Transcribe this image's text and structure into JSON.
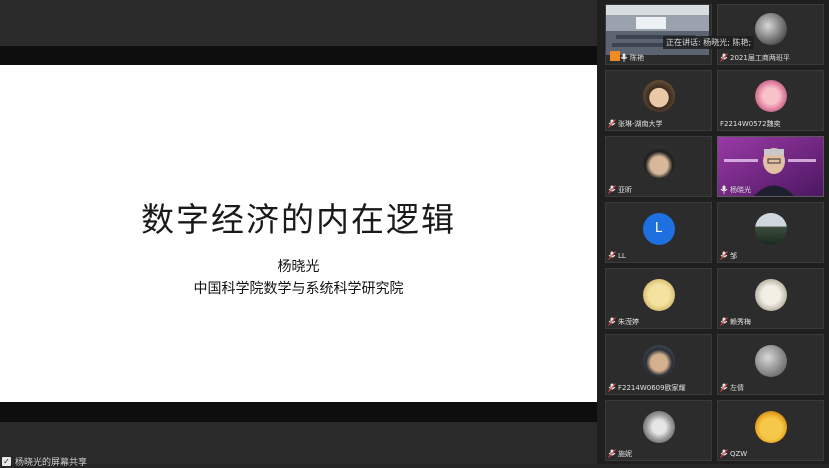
{
  "slide": {
    "title": "数字经济的内在逻辑",
    "author": "杨晓光",
    "affiliation": "中国科学院数学与系统科学研究院"
  },
  "screen_share_indicator": "杨晓光的屏幕共享",
  "speaking_now": "正在讲话: 杨晓光; 陈艳;",
  "participants": [
    {
      "name": "陈艳",
      "avatar": "classroom-video"
    },
    {
      "name": "2021届工商两班平",
      "avatar": "planet-photo"
    },
    {
      "name": "张琳-湖南大学",
      "avatar": "child-photo"
    },
    {
      "name": "F2214W0572魏奕",
      "avatar": "pink-costume-photo"
    },
    {
      "name": "亚昕",
      "avatar": "young-man-photo"
    },
    {
      "name": "杨晓光",
      "avatar": "speaker-video"
    },
    {
      "name": "LL",
      "avatar": "letter-L",
      "letter": "L"
    },
    {
      "name": "邹",
      "avatar": "landscape-photo"
    },
    {
      "name": "朱滢婷",
      "avatar": "cartoon-dog"
    },
    {
      "name": "赖秀梅",
      "avatar": "sketch-portrait"
    },
    {
      "name": "F2214W0609欧家耀",
      "avatar": "man-glasses-photo"
    },
    {
      "name": "左倩",
      "avatar": "texture-photo"
    },
    {
      "name": "施妮",
      "avatar": "cat-photo"
    },
    {
      "name": "QZW",
      "avatar": "cartoon-fruit"
    }
  ],
  "colors": {
    "accent_blue": "#1e6fe0",
    "speaker_tile": "#7a2a8a"
  }
}
